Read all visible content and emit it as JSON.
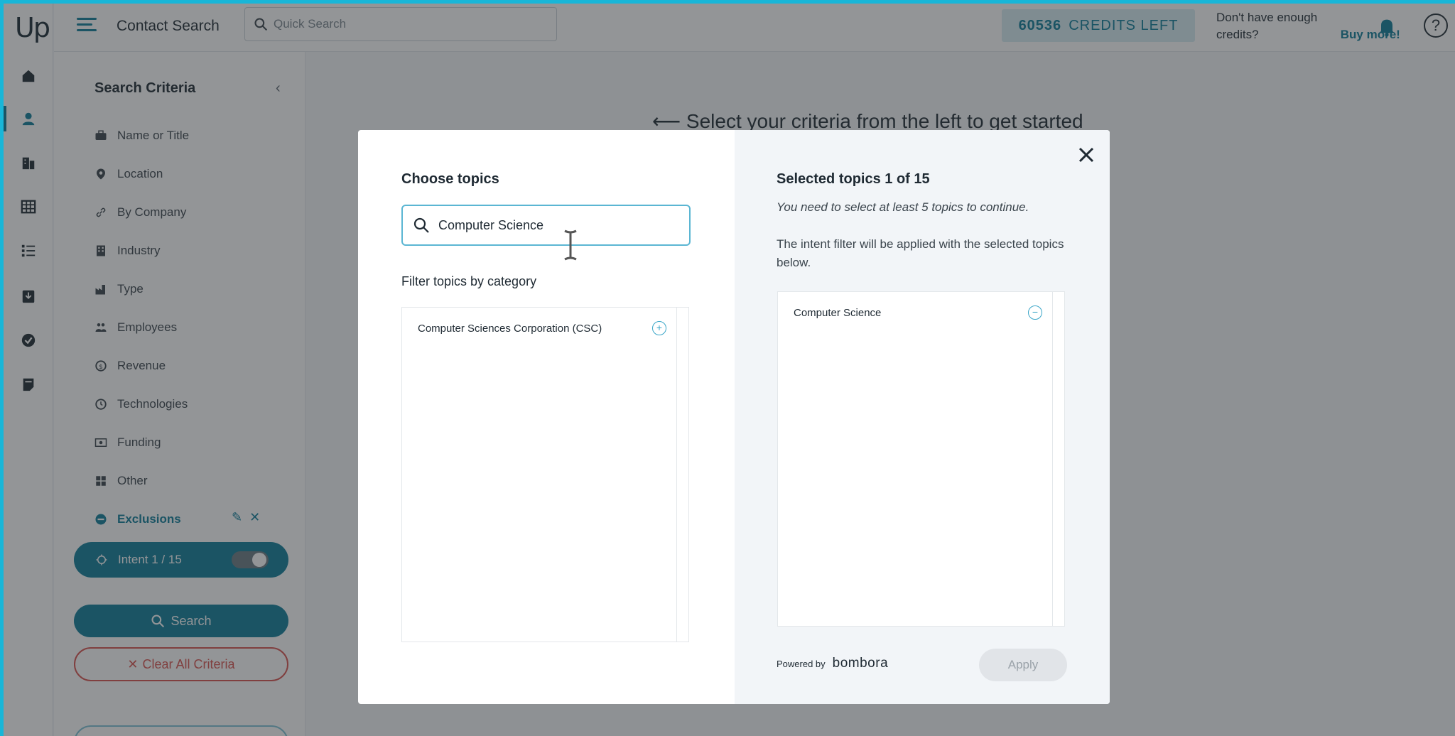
{
  "app": {
    "logo": "Up",
    "title": "Contact Search"
  },
  "header": {
    "search_placeholder": "Quick Search",
    "credits_number": "60536",
    "credits_label": "CREDITS LEFT",
    "buy_more_text": "Don't have enough credits?",
    "buy_more_link": "Buy more!"
  },
  "rail": {
    "items": [
      {
        "icon": "home-icon"
      },
      {
        "icon": "person-icon"
      },
      {
        "icon": "building-icon"
      },
      {
        "icon": "table-icon"
      },
      {
        "icon": "list-icon"
      },
      {
        "icon": "download-icon"
      },
      {
        "icon": "check-circle-icon"
      },
      {
        "icon": "note-icon"
      }
    ]
  },
  "sidebar": {
    "title": "Search Criteria",
    "criteria": [
      {
        "label": "Name or Title",
        "icon": "briefcase-icon"
      },
      {
        "label": "Location",
        "icon": "pin-icon"
      },
      {
        "label": "By Company",
        "icon": "link-icon"
      },
      {
        "label": "Industry",
        "icon": "building-icon"
      },
      {
        "label": "Type",
        "icon": "factory-icon"
      },
      {
        "label": "Employees",
        "icon": "people-icon"
      },
      {
        "label": "Revenue",
        "icon": "dollar-icon"
      },
      {
        "label": "Technologies",
        "icon": "chip-icon"
      },
      {
        "label": "Funding",
        "icon": "money-icon"
      },
      {
        "label": "Other",
        "icon": "grid-icon"
      },
      {
        "label": "Exclusions",
        "icon": "minus-circle-icon"
      }
    ],
    "intent_label": "Intent 1 / 15",
    "search_label": "Search",
    "clear_label": "Clear All Criteria"
  },
  "main": {
    "hint": "Select your criteria from the left to get started"
  },
  "modal": {
    "choose_title": "Choose topics",
    "search_value": "Computer Science",
    "filter_label": "Filter topics by category",
    "results": [
      "Computer Sciences Corporation (CSC)"
    ],
    "selected_title": "Selected topics 1 of 15",
    "warning": "You need to select at least 5 topics to continue.",
    "note": "The intent filter will be applied with the selected topics below.",
    "selected": [
      "Computer Science"
    ],
    "powered_by": "Powered by",
    "brand": "bombora",
    "apply_label": "Apply"
  },
  "colors": {
    "accent": "#0e7c99",
    "danger": "#d9534f",
    "frame": "#18b6d8"
  }
}
